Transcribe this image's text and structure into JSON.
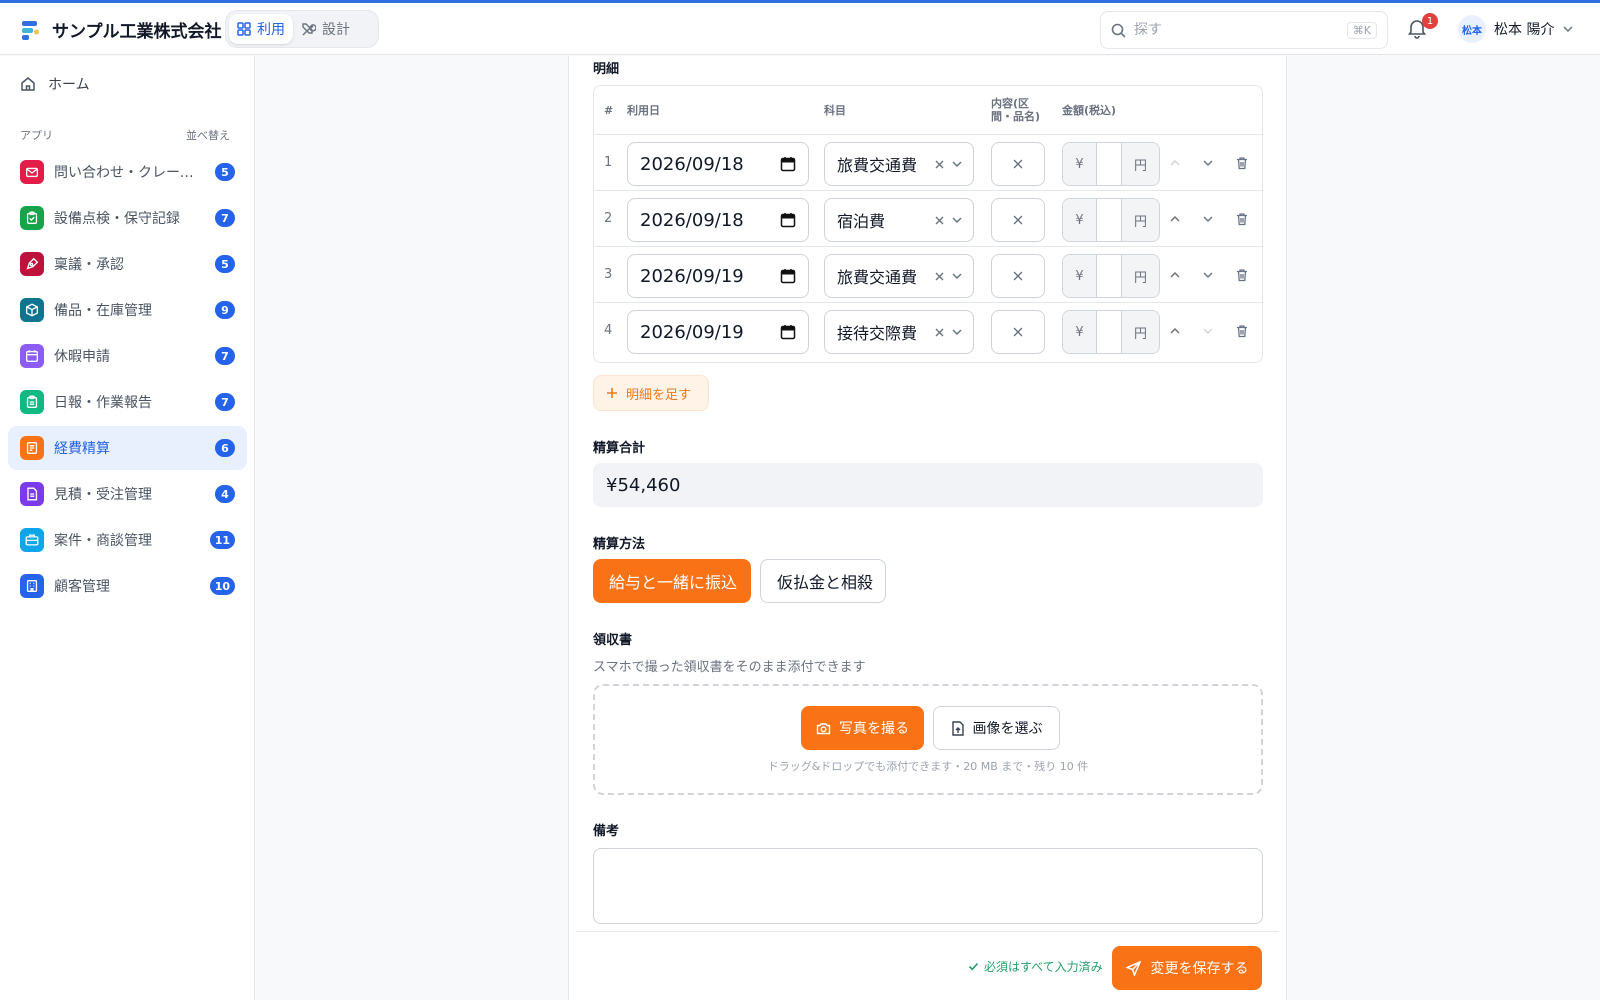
{
  "company": "サンプル工業株式会社",
  "modes": {
    "use": "利用",
    "design": "設計"
  },
  "search": {
    "placeholder": "探す",
    "shortcut": "⌘K"
  },
  "notifications": {
    "count": "1"
  },
  "user": {
    "initials": "松本",
    "name": "松本 陽介"
  },
  "sidebar": {
    "home": "ホーム",
    "section_label": "アプリ",
    "sort_label": "並べ替え",
    "items": [
      {
        "label": "問い合わせ・クレーム管理",
        "count": "5",
        "color": "#e11d48",
        "icon": "mail-icon"
      },
      {
        "label": "設備点検・保守記録",
        "count": "7",
        "color": "#16a34a",
        "icon": "clipboard-check-icon"
      },
      {
        "label": "稟議・承認",
        "count": "5",
        "color": "#be123c",
        "icon": "pen-tool-icon"
      },
      {
        "label": "備品・在庫管理",
        "count": "9",
        "color": "#0e7490",
        "icon": "box-icon"
      },
      {
        "label": "休暇申請",
        "count": "7",
        "color": "#8b5cf6",
        "icon": "calendar-icon"
      },
      {
        "label": "日報・作業報告",
        "count": "7",
        "color": "#10b981",
        "icon": "clipboard-icon"
      },
      {
        "label": "経費精算",
        "count": "6",
        "color": "#f97316",
        "icon": "receipt-icon",
        "active": true
      },
      {
        "label": "見積・受注管理",
        "count": "4",
        "color": "#7c3aed",
        "icon": "document-icon"
      },
      {
        "label": "案件・商談管理",
        "count": "11",
        "color": "#0ea5e9",
        "icon": "briefcase-icon"
      },
      {
        "label": "顧客管理",
        "count": "10",
        "color": "#2563eb",
        "icon": "building-icon"
      }
    ]
  },
  "form": {
    "details_label": "明細",
    "columns": {
      "num": "#",
      "date": "利用日",
      "category": "科目",
      "memo": "内容(区間・品名)",
      "amount": "金額(税込)"
    },
    "rows": [
      {
        "num": "1",
        "date": "2026/09/18",
        "category": "旅費交通費"
      },
      {
        "num": "2",
        "date": "2026/09/18",
        "category": "宿泊費"
      },
      {
        "num": "3",
        "date": "2026/09/19",
        "category": "旅費交通費"
      },
      {
        "num": "4",
        "date": "2026/09/19",
        "category": "接待交際費"
      }
    ],
    "currency_prefix": "¥",
    "currency_suffix": "円",
    "add_line": "明細を足す",
    "total_label": "精算合計",
    "total_value": "¥54,460",
    "method_label": "精算方法",
    "method_selected": "給与と一緒に振込",
    "method_other": "仮払金と相殺",
    "receipt_label": "領収書",
    "receipt_hint": "スマホで撮った領収書をそのまま添付できます",
    "take_photo": "写真を撮る",
    "choose_image": "画像を選ぶ",
    "drop_note": "ドラッグ&ドロップでも添付できます・20 MB まで・残り 10 件",
    "notes_label": "備考",
    "required_ok": "必須はすべて入力済み",
    "save": "変更を保存する"
  }
}
